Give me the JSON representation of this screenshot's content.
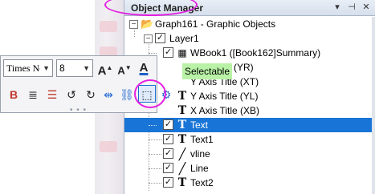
{
  "panel": {
    "title": "Object Manager",
    "controls": [
      "▾",
      "⊣",
      "✕"
    ]
  },
  "tree": {
    "root": "Graph161 - Graphic Objects",
    "layer": "Layer1",
    "items": [
      {
        "label": "WBook1 ([Book162]Summary)",
        "icon": "table-icon"
      },
      {
        "label": "(YR)",
        "icon": "text-icon"
      },
      {
        "label": "Y Axis Title (XT)",
        "icon": "text-icon"
      },
      {
        "label": "Y Axis Title (YL)",
        "icon": "text-icon"
      },
      {
        "label": "X Axis Title (XB)",
        "icon": "text-icon"
      },
      {
        "label": "Text",
        "icon": "text-icon",
        "selected": true
      },
      {
        "label": "Text1",
        "icon": "text-icon"
      },
      {
        "label": "vline",
        "icon": "line-icon"
      },
      {
        "label": "Line",
        "icon": "line-icon"
      },
      {
        "label": "Text2",
        "icon": "text-icon"
      }
    ]
  },
  "toolbar": {
    "font": "Times New Roman",
    "size": "8",
    "grip": "• • •"
  },
  "tooltip": "Selectable",
  "colors": {
    "selection": "#1874d6",
    "highlight": "#e31fe0",
    "tooltip_bg": "#b9f2a6"
  }
}
